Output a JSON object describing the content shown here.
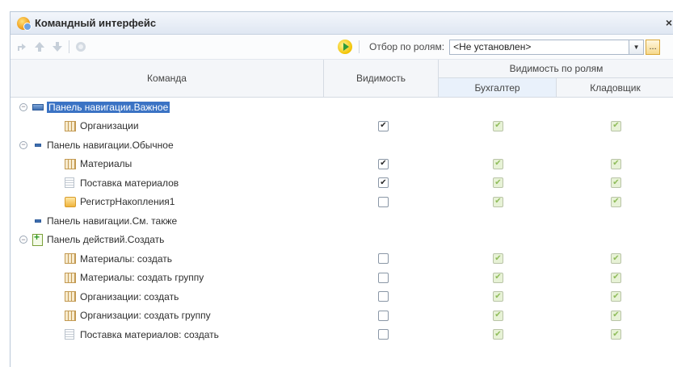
{
  "window": {
    "title": "Командный интерфейс",
    "close": "×"
  },
  "toolbar": {
    "filter_label": "Отбор по ролям:",
    "filter_value": "<Не установлен>",
    "dropdown": "▼",
    "ellipsis": "..."
  },
  "columns": {
    "command": "Команда",
    "visibility": "Видимость",
    "role_visibility": "Видимость по ролям",
    "role1": "Бухгалтер",
    "role2": "Кладовщик"
  },
  "rows": [
    {
      "label": "Панель навигации.Важное",
      "level": 0,
      "toggle": "−",
      "icon": "panel-main-icon",
      "selected": true,
      "vis": null,
      "r1": null,
      "r2": null
    },
    {
      "label": "Организации",
      "level": 1,
      "icon": "catalog-icon",
      "vis": true,
      "r1": true,
      "r2": true
    },
    {
      "label": "Панель навигации.Обычное",
      "level": 0,
      "toggle": "−",
      "icon": "panel-icon",
      "vis": null,
      "r1": null,
      "r2": null
    },
    {
      "label": "Материалы",
      "level": 1,
      "icon": "catalog-icon",
      "vis": true,
      "r1": true,
      "r2": true
    },
    {
      "label": "Поставка материалов",
      "level": 1,
      "icon": "document-icon",
      "vis": true,
      "r1": true,
      "r2": true
    },
    {
      "label": "РегистрНакопления1",
      "level": 1,
      "icon": "register-icon",
      "vis": false,
      "r1": true,
      "r2": true
    },
    {
      "label": "Панель навигации.См. также",
      "level": 0,
      "toggle": "",
      "icon": "panel-icon",
      "vis": null,
      "r1": null,
      "r2": null
    },
    {
      "label": "Панель действий.Создать",
      "level": 0,
      "toggle": "−",
      "icon": "create-icon",
      "vis": null,
      "r1": null,
      "r2": null
    },
    {
      "label": "Материалы: создать",
      "level": 1,
      "icon": "catalog-icon",
      "vis": false,
      "r1": true,
      "r2": true
    },
    {
      "label": "Материалы: создать группу",
      "level": 1,
      "icon": "catalog-icon",
      "vis": false,
      "r1": true,
      "r2": true
    },
    {
      "label": "Организации: создать",
      "level": 1,
      "icon": "catalog-icon",
      "vis": false,
      "r1": true,
      "r2": true
    },
    {
      "label": "Организации: создать группу",
      "level": 1,
      "icon": "catalog-icon",
      "vis": false,
      "r1": true,
      "r2": true
    },
    {
      "label": "Поставка материалов: создать",
      "level": 1,
      "icon": "document-icon",
      "vis": false,
      "r1": true,
      "r2": true
    }
  ]
}
